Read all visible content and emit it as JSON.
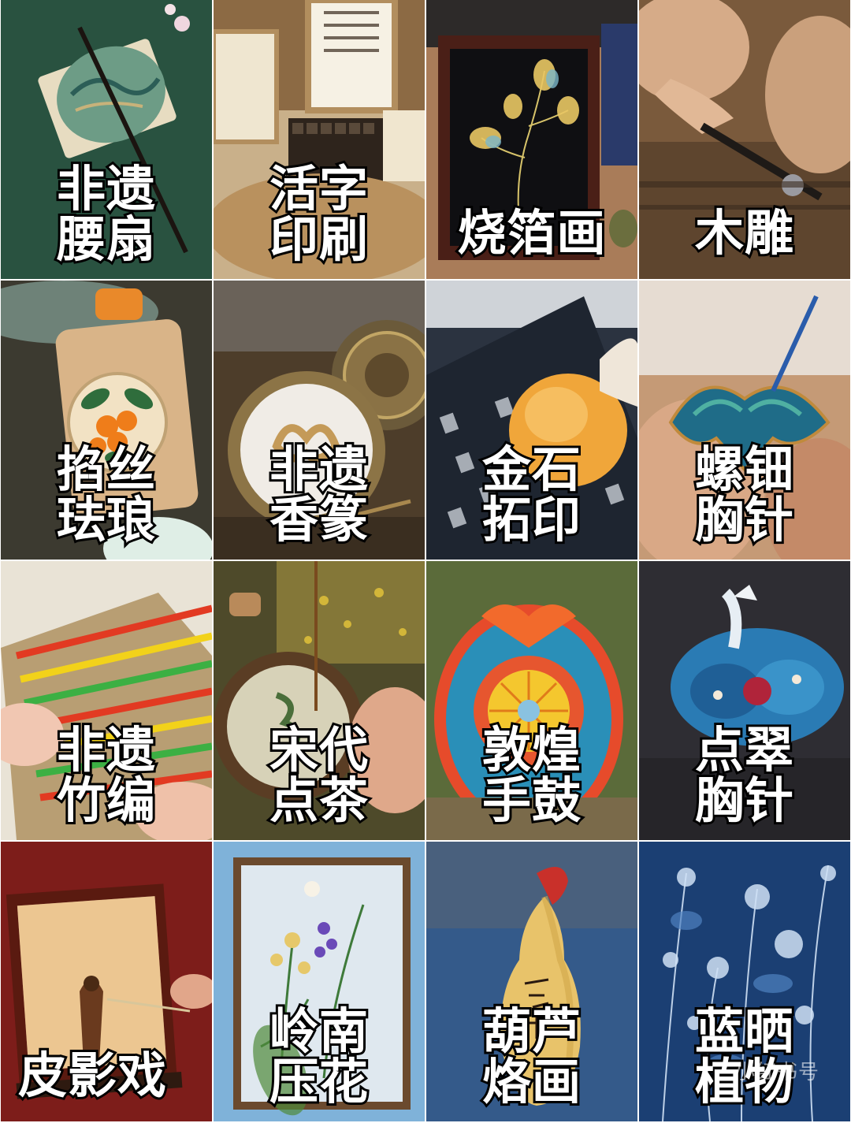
{
  "tiles": [
    {
      "lines": [
        "非遗",
        "腰扇"
      ],
      "bg": "#2f5a47",
      "accent": "#c8b27a"
    },
    {
      "lines": [
        "活字",
        "印刷"
      ],
      "bg": "#c9b08a",
      "accent": "#3a2a1e"
    },
    {
      "lines": [
        "烧箔画"
      ],
      "bg": "#4a1f17",
      "accent": "#d7c36a"
    },
    {
      "lines": [
        "木雕"
      ],
      "bg": "#7a5a3c",
      "accent": "#c59a72"
    },
    {
      "lines": [
        "掐丝",
        "珐琅"
      ],
      "bg": "#3c3a30",
      "accent": "#e9892a"
    },
    {
      "lines": [
        "非遗",
        "香篆"
      ],
      "bg": "#4d3d2a",
      "accent": "#b8995a"
    },
    {
      "lines": [
        "金石",
        "拓印"
      ],
      "bg": "#2b3340",
      "accent": "#f0a63a"
    },
    {
      "lines": [
        "螺钿",
        "胸针"
      ],
      "bg": "#c59a76",
      "accent": "#1f6c88"
    },
    {
      "lines": [
        "非遗",
        "竹编"
      ],
      "bg": "#e9e3d6",
      "accent": "#e23a22"
    },
    {
      "lines": [
        "宋代",
        "点茶"
      ],
      "bg": "#4e4a2a",
      "accent": "#d7d2b8"
    },
    {
      "lines": [
        "敦煌",
        "手鼓"
      ],
      "bg": "#5b6b3a",
      "accent": "#e64b2b"
    },
    {
      "lines": [
        "点翠",
        "胸针"
      ],
      "bg": "#2e2d33",
      "accent": "#2a7bb4"
    },
    {
      "lines": [
        "皮影戏"
      ],
      "bg": "#7d1d1a",
      "accent": "#f2d9a7"
    },
    {
      "lines": [
        "岭南",
        "压花"
      ],
      "bg": "#7fb2d9",
      "accent": "#e6c86a"
    },
    {
      "lines": [
        "葫芦",
        "烙画"
      ],
      "bg": "#345a8a",
      "accent": "#e8c36a"
    },
    {
      "lines": [
        "蓝晒",
        "植物"
      ],
      "bg": "#1b3f73",
      "accent": "#cfe0f4"
    }
  ],
  "watermark": "小红书号"
}
